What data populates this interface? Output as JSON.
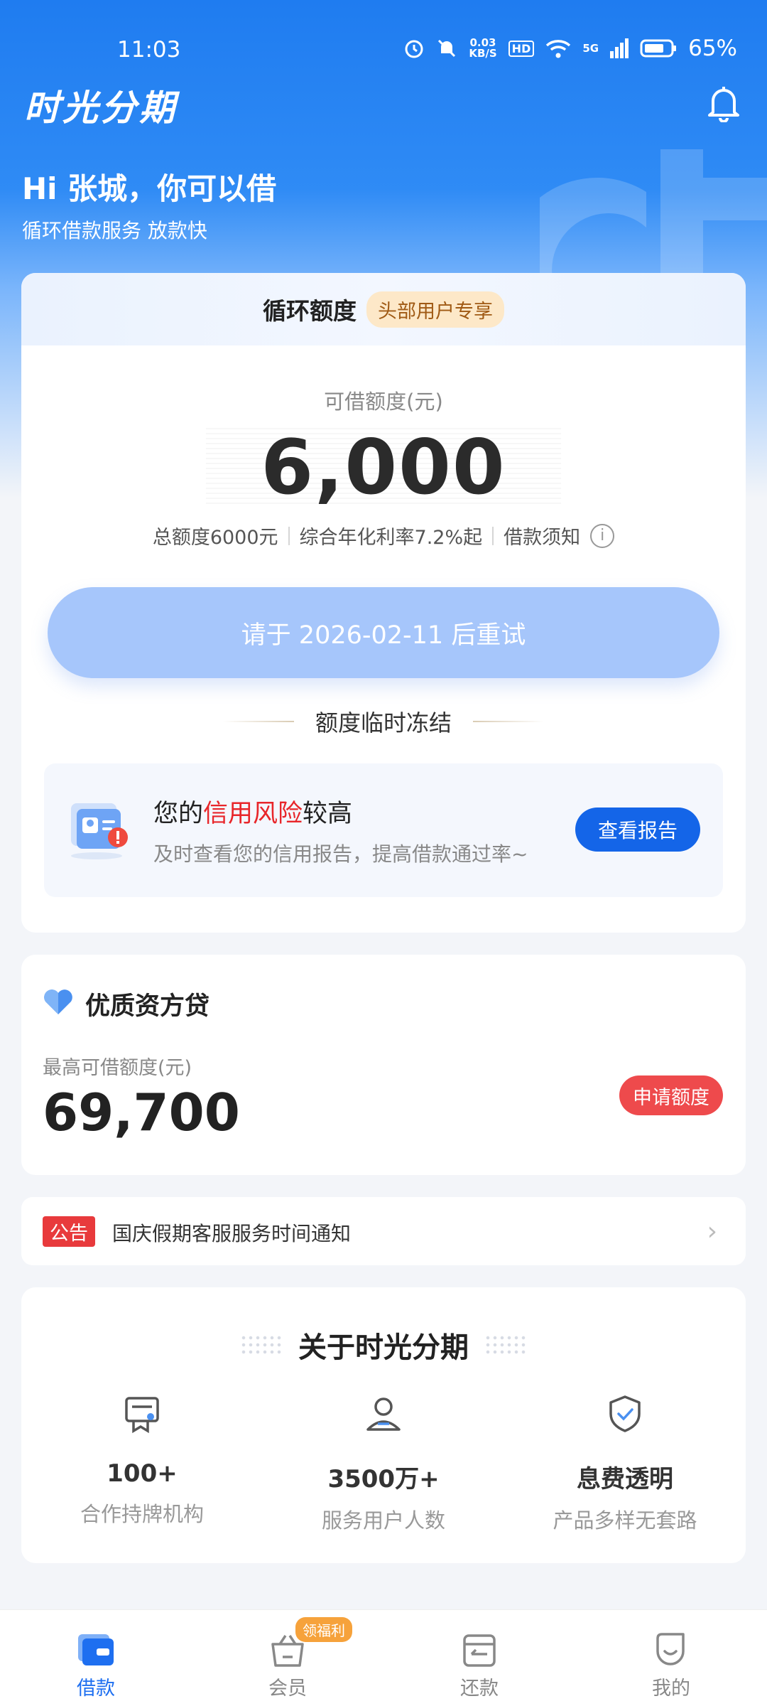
{
  "status_bar": {
    "time": "11:03",
    "net_speed": "0.03",
    "net_speed_unit": "KB/S",
    "hd": "HD",
    "signal": "5G",
    "battery": "65%"
  },
  "header": {
    "app_title": "时光分期",
    "bell_icon": "bell-icon"
  },
  "greeting": {
    "title": "Hi 张城，你可以借",
    "subtitle": "循环借款服务 放款快"
  },
  "main_card": {
    "head_title": "循环额度",
    "badge": "头部用户专享",
    "avail_label": "可借额度(元)",
    "avail_amount": "6,000",
    "meta": [
      "总额度6000元",
      "综合年化利率7.2%起",
      "借款须知"
    ],
    "info_icon": "info-icon",
    "retry_button": "请于 2026-02-11 后重试",
    "freeze_text": "额度临时冻结",
    "risk": {
      "title_prefix": "您的",
      "title_highlight": "信用风险",
      "title_suffix": "较高",
      "subtitle": "及时查看您的信用报告，提高借款通过率~",
      "button": "查看报告"
    }
  },
  "loan_card": {
    "title": "优质资方贷",
    "label": "最高可借额度(元)",
    "amount": "69,700",
    "button": "申请额度"
  },
  "notice": {
    "tag": "公告",
    "text": "国庆假期客服服务时间通知",
    "arrow": "›"
  },
  "about": {
    "title": "关于时光分期",
    "items": [
      {
        "icon": "institution-icon",
        "value": "100+",
        "desc": "合作持牌机构"
      },
      {
        "icon": "user-icon",
        "value": "3500万+",
        "desc": "服务用户人数"
      },
      {
        "icon": "shield-check-icon",
        "value": "息费透明",
        "desc": "产品多样无套路"
      }
    ]
  },
  "tabbar": {
    "tabs": [
      {
        "label": "借款",
        "icon": "wallet-icon",
        "active": true
      },
      {
        "label": "会员",
        "icon": "basket-icon",
        "badge": "领福利"
      },
      {
        "label": "还款",
        "icon": "repay-icon"
      },
      {
        "label": "我的",
        "icon": "profile-icon"
      }
    ]
  },
  "colors": {
    "brand_blue": "#1f7cf0",
    "button_blue": "#1465e8",
    "risk_red": "#e8262a",
    "apply_red": "#ee4a4c",
    "badge_orange": "#f6a23b"
  }
}
